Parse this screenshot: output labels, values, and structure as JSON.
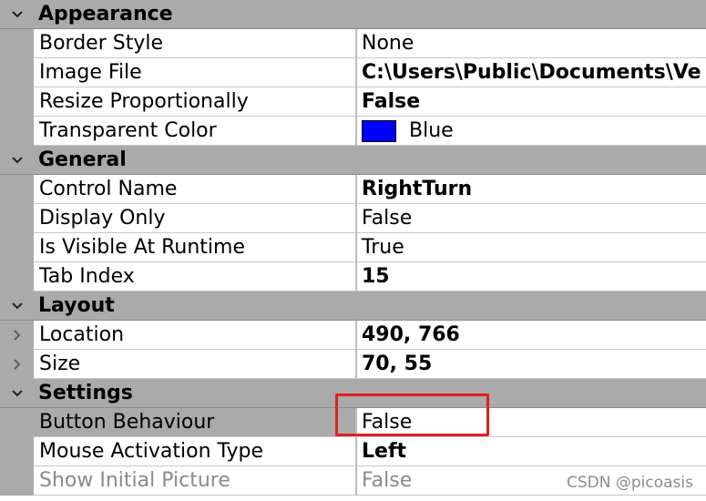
{
  "categories": [
    {
      "title": "Appearance",
      "rows": [
        {
          "name": "Border Style",
          "value": "None",
          "bold": false
        },
        {
          "name": "Image File",
          "value": "C:\\Users\\Public\\Documents\\Ve",
          "bold": true
        },
        {
          "name": "Resize Proportionally",
          "value": "False",
          "bold": true
        },
        {
          "name": "Transparent Color",
          "value": "Blue",
          "bold": false,
          "swatch": "#0000ff"
        }
      ]
    },
    {
      "title": "General",
      "rows": [
        {
          "name": "Control Name",
          "value": "RightTurn",
          "bold": true
        },
        {
          "name": "Display Only",
          "value": "False",
          "bold": false
        },
        {
          "name": "Is Visible At Runtime",
          "value": "True",
          "bold": false
        },
        {
          "name": "Tab Index",
          "value": "15",
          "bold": true
        }
      ]
    },
    {
      "title": "Layout",
      "rows": [
        {
          "name": "Location",
          "value": "490, 766",
          "bold": true,
          "expandable": true
        },
        {
          "name": "Size",
          "value": "70, 55",
          "bold": true,
          "expandable": true
        }
      ]
    },
    {
      "title": "Settings",
      "rows": [
        {
          "name": "Button Behaviour",
          "value": "False",
          "bold": false
        },
        {
          "name": "Mouse Activation Type",
          "value": "Left",
          "bold": true
        },
        {
          "name": "Show Initial Picture",
          "value": "False",
          "bold": false,
          "disabled": true
        }
      ]
    }
  ],
  "watermark": "CSDN @picoasis",
  "colors": {
    "category_bg": "#aaaaaa",
    "highlight": "#e02020",
    "swatch": "#0000ff"
  },
  "icons": {
    "category_toggle": "chevron-down-icon",
    "row_expand": "chevron-right-icon"
  }
}
